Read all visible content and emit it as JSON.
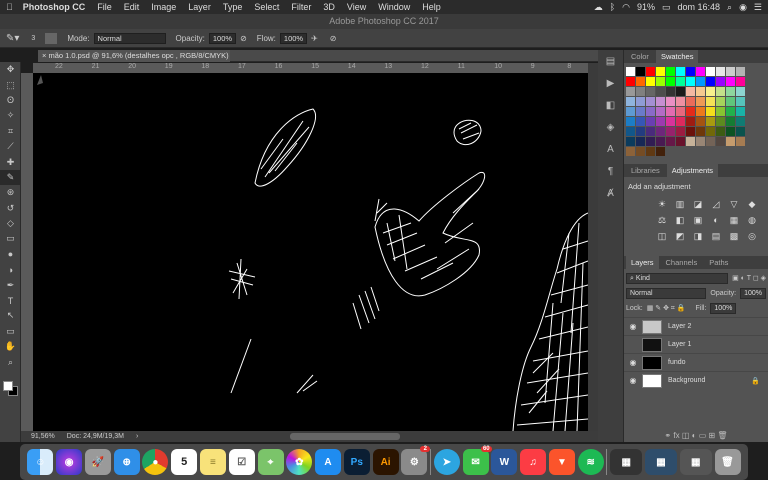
{
  "menubar": {
    "app": "Photoshop CC",
    "items": [
      "File",
      "Edit",
      "Image",
      "Layer",
      "Type",
      "Select",
      "Filter",
      "3D",
      "View",
      "Window",
      "Help"
    ],
    "battery": "91%",
    "clock": "dom 16:48"
  },
  "window": {
    "title": "Adobe Photoshop CC 2017"
  },
  "options": {
    "brush_size": "3",
    "mode_label": "Mode:",
    "mode_value": "Normal",
    "opacity_label": "Opacity:",
    "opacity_value": "100%",
    "flow_label": "Flow:",
    "flow_value": "100%"
  },
  "document": {
    "tab_title": "mão 1.0.psd @ 91,6% (destalhes opc , RGB/8/CMYK) *",
    "ruler_ticks": [
      "22",
      "21",
      "20",
      "19",
      "18",
      "17",
      "16",
      "15",
      "14",
      "13",
      "12",
      "11",
      "10",
      "9",
      "8",
      "7"
    ]
  },
  "status": {
    "zoom": "91,56%",
    "doc": "Doc: 24,9M/19,3M"
  },
  "panels": {
    "color_tab": "Color",
    "swatches_tab": "Swatches",
    "libraries_tab": "Libraries",
    "adjustments_tab": "Adjustments",
    "adjustments_title": "Add an adjustment",
    "layers_tab": "Layers",
    "channels_tab": "Channels",
    "paths_tab": "Paths",
    "kind_label": "Kind",
    "blend_mode": "Normal",
    "opacity_label": "Opacity:",
    "opacity_value": "100%",
    "lock_label": "Lock:",
    "fill_label": "Fill:",
    "fill_value": "100%",
    "layers": [
      {
        "name": "Layer 2",
        "visible": true,
        "thumb": "#c8c8c8"
      },
      {
        "name": "Layer 1",
        "visible": false,
        "thumb": "#111111"
      },
      {
        "name": "fundo",
        "visible": true,
        "thumb": "#000000"
      },
      {
        "name": "Background",
        "visible": true,
        "thumb": "#ffffff"
      }
    ]
  },
  "swatch_colors": [
    "#ffffff",
    "#000000",
    "#ff0000",
    "#ffff00",
    "#00ff00",
    "#00ffff",
    "#0000ff",
    "#ff00ff",
    "#ffffff",
    "#e6e6e6",
    "#cccccc",
    "#b3b3b3",
    "#ff0000",
    "#ff6600",
    "#ffff00",
    "#99ff00",
    "#00ff00",
    "#00ff99",
    "#00ffff",
    "#0099ff",
    "#0000ff",
    "#9900ff",
    "#ff00ff",
    "#ff0099",
    "#999999",
    "#808080",
    "#666666",
    "#4d4d4d",
    "#333333",
    "#1a1a1a",
    "#f2b8a2",
    "#f5c98f",
    "#f8f08c",
    "#c4e08a",
    "#8ed79e",
    "#8dd5d0",
    "#8fb4dd",
    "#8f9cd6",
    "#a48fd4",
    "#c68fd2",
    "#ea8fc4",
    "#ee8fa2",
    "#e96b5a",
    "#ee9a55",
    "#f4e256",
    "#a6d35b",
    "#5fc67b",
    "#56c4bb",
    "#5e9ad2",
    "#6a7bca",
    "#8a6ac8",
    "#b46bc6",
    "#e26bb0",
    "#e6687e",
    "#e42b1b",
    "#ec7a1c",
    "#f3dd1c",
    "#86c431",
    "#22b14c",
    "#19b3a7",
    "#1d7dc5",
    "#3657b5",
    "#6a3fb2",
    "#9d3aaf",
    "#d8339b",
    "#dd2a5e",
    "#9e1c12",
    "#a45311",
    "#a89a10",
    "#5c8a1f",
    "#157c33",
    "#107b73",
    "#12578a",
    "#233c80",
    "#4a2b7c",
    "#6e277b",
    "#97226c",
    "#9c1c41",
    "#6b120b",
    "#6e370a",
    "#716809",
    "#3d5c13",
    "#0d5322",
    "#0a534d",
    "#0b3b5d",
    "#172856",
    "#311d53",
    "#491a52",
    "#661748",
    "#69122b",
    "#c7b299",
    "#998675",
    "#736357",
    "#534741",
    "#c69c6d",
    "#a67c52",
    "#8c6239",
    "#754c24",
    "#603913",
    "#42210b"
  ],
  "adjustment_icons": [
    "☀",
    "▥",
    "◪",
    "◿",
    "▽",
    "◆",
    "⚖",
    "◧",
    "▣",
    "◐",
    "▦",
    "◍",
    "◫",
    "◩",
    "◨",
    "▤",
    "▩",
    "◎"
  ],
  "tools": [
    "move-tool",
    "marquee-tool",
    "lasso-tool",
    "quick-select-tool",
    "crop-tool",
    "eyedropper-tool",
    "healing-tool",
    "brush-tool",
    "stamp-tool",
    "history-brush-tool",
    "eraser-tool",
    "gradient-tool",
    "blur-tool",
    "dodge-tool",
    "pen-tool",
    "type-tool",
    "path-select-tool",
    "rectangle-tool",
    "hand-tool",
    "zoom-tool"
  ],
  "dock": {
    "messages_badge": "60",
    "settings_badge": "2",
    "calendar_day": "5"
  }
}
